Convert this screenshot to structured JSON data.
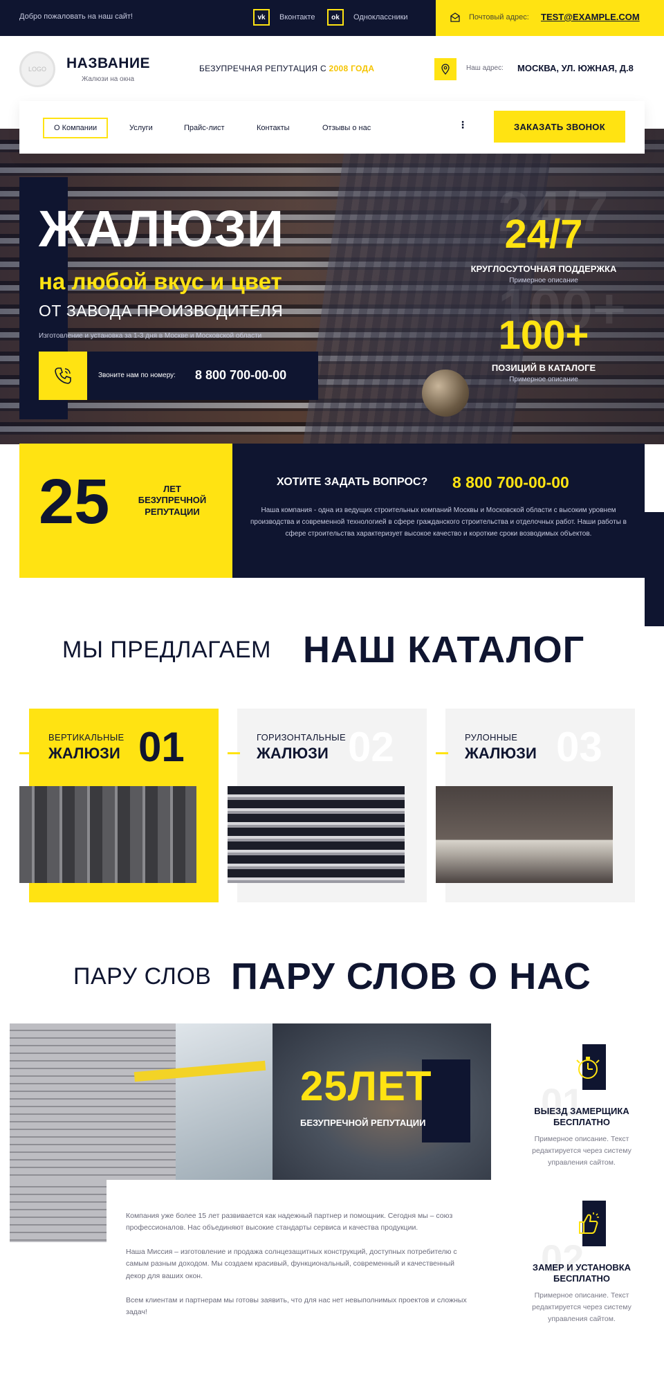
{
  "topbar": {
    "welcome": "Добро пожаловать на наш сайт!",
    "social": [
      {
        "icon": "vk-icon",
        "glyph": "vk",
        "label": "Вконтакте"
      },
      {
        "icon": "odnoklassniki-icon",
        "glyph": "ok",
        "label": "Одноклассники"
      }
    ],
    "mail_label": "Почтовый адрес:",
    "mail_value": "TEST@EXAMPLE.COM"
  },
  "header": {
    "logo_text": "LOGO",
    "brand_name": "НАЗВАНИЕ",
    "brand_sub": "Жалюзи на окна",
    "reputation_prefix": "БЕЗУПРЕЧНАЯ РЕПУТАЦИЯ С ",
    "reputation_year": "2008 ГОДА",
    "address_label": "Наш адрес:",
    "address_value": "МОСКВА, УЛ. ЮЖНАЯ, Д.8"
  },
  "nav": {
    "items": [
      "О Компании",
      "Услуги",
      "Прайс-лист",
      "Контакты",
      "Отзывы о нас"
    ],
    "more": "⋮",
    "cta": "ЗАКАЗАТЬ ЗВОНОК"
  },
  "hero": {
    "title": "ЖАЛЮЗИ",
    "subtitle_yellow": "на любой вкус и цвет",
    "subtitle_white": "ОТ ЗАВОДА ПРОИЗВОДИТЕЛЯ",
    "small": "Изготовление и установка за 1-3 дня в Москве и Московской области",
    "phone_label": "Звоните нам по номеру:",
    "phone_number": "8 800 700-00-00",
    "stats": [
      {
        "bg": "24/7",
        "value": "24/7",
        "label": "КРУГЛОСУТОЧНАЯ ПОДДЕРЖКА",
        "sub": "Примерное описание"
      },
      {
        "bg": "100+",
        "value": "100+",
        "label": "ПОЗИЦИЙ В КАТАЛОГЕ",
        "sub": "Примерное описание"
      }
    ]
  },
  "years_band": {
    "number": "25",
    "text": "ЛЕТ БЕЗУПРЕЧНОЙ РЕПУТАЦИИ",
    "question": "ХОТИТЕ ЗАДАТЬ ВОПРОС?",
    "phone": "8 800 700-00-00",
    "description": "Наша компания - одна из ведущих строительных компаний Москвы и Московской области с высоким уровнем производства и современной технологией в сфере гражданского строительства и отделочных работ. Наши работы в сфере строительства характеризует высокое качество и короткие сроки возводимых объектов."
  },
  "catalog": {
    "heading_light": "МЫ ПРЕДЛАГАЕМ",
    "heading_bold": "НАШ КАТАЛОГ",
    "cards": [
      {
        "sub": "ВЕРТИКАЛЬНЫЕ",
        "title": "ЖАЛЮЗИ",
        "number": "01"
      },
      {
        "sub": "ГОРИЗОНТАЛЬНЫЕ",
        "title": "ЖАЛЮЗИ",
        "number": "02"
      },
      {
        "sub": "РУЛОННЫЕ",
        "title": "ЖАЛЮЗИ",
        "number": "03"
      }
    ]
  },
  "about": {
    "heading_light": "ПАРУ СЛОВ",
    "heading_bold": "ПАРУ СЛОВ О НАС",
    "years": "25ЛЕТ",
    "years_sub": "БЕЗУПРЕЧНОЙ РЕПУТАЦИИ",
    "paragraphs": [
      "Компания уже более 15 лет развивается как надежный партнер и помощник. Сегодня мы – союз профессионалов. Нас объединяют высокие стандарты сервиса и качества продукции.",
      "Наша Миссия – изготовление и продажа солнцезащитных конструкций, доступных потребителю с самым разным доходом. Мы создаем красивый, функциональный, современный и качественный декор для ваших окон.",
      "Всем клиентам и партнерам мы готовы заявить, что для нас нет невыполнимых проектов и сложных задач!"
    ],
    "features": [
      {
        "icon": "stopwatch-icon",
        "bg_number": "01",
        "title": "ВЫЕЗД ЗАМЕРЩИКА БЕСПЛАТНО",
        "description": "Примерное описание. Текст редактируется через систему управления сайтом."
      },
      {
        "icon": "thumbs-up-icon",
        "bg_number": "02",
        "title": "ЗАМЕР И УСТАНОВКА БЕСПЛАТНО",
        "description": "Примерное описание. Текст редактируется через систему управления сайтом."
      }
    ]
  },
  "colors": {
    "navy": "#0f1530",
    "yellow": "#ffe312",
    "light_gray": "#f3f3f3"
  }
}
